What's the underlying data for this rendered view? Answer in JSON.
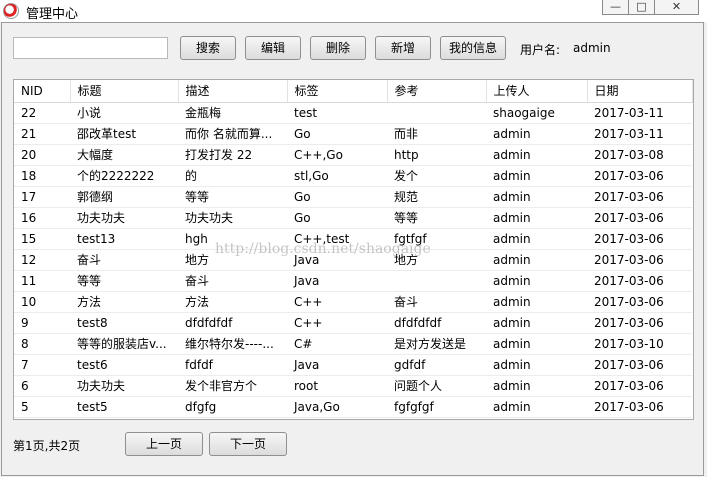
{
  "window": {
    "title": "管理中心",
    "min_label": "—",
    "max_label": "□",
    "close_label": "✕"
  },
  "toolbar": {
    "search_value": "",
    "search_label": "搜索",
    "edit_label": "编辑",
    "delete_label": "删除",
    "add_label": "新增",
    "myinfo_label": "我的信息",
    "user_label": "用户名:",
    "user_name": "admin"
  },
  "table": {
    "columns": [
      "NID",
      "标题",
      "描述",
      "标签",
      "参考",
      "上传人",
      "日期"
    ],
    "rows": [
      [
        "22",
        "小说",
        "金瓶梅",
        "test",
        "",
        "shaogaige",
        "2017-03-11"
      ],
      [
        "21",
        "邵改革test",
        "而你 名就而算...",
        "Go",
        "而非",
        "admin",
        "2017-03-11"
      ],
      [
        "20",
        "大幅度",
        "打发打发 22",
        "C++,Go",
        "http",
        "admin",
        "2017-03-08"
      ],
      [
        "18",
        "个的2222222",
        "的",
        "stl,Go",
        "发个",
        "admin",
        "2017-03-06"
      ],
      [
        "17",
        "郭德纲",
        "等等",
        "Go",
        "规范",
        "admin",
        "2017-03-06"
      ],
      [
        "16",
        "功夫功夫",
        "功夫功夫",
        "Go",
        "等等",
        "admin",
        "2017-03-06"
      ],
      [
        "15",
        "test13",
        "hgh",
        "C++,test",
        "fgtfgf",
        "admin",
        "2017-03-06"
      ],
      [
        "12",
        "奋斗",
        "地方",
        "Java",
        "地方",
        "admin",
        "2017-03-06"
      ],
      [
        "11",
        "等等",
        "奋斗",
        "Java",
        "",
        "admin",
        "2017-03-06"
      ],
      [
        "10",
        "方法",
        "方法",
        "C++",
        "奋斗",
        "admin",
        "2017-03-06"
      ],
      [
        "9",
        "test8",
        "dfdfdfdf",
        "C++",
        "dfdfdfdf",
        "admin",
        "2017-03-06"
      ],
      [
        "8",
        "等等的服装店v...",
        "维尔特尔发----...",
        "C#",
        "是对方发送是",
        "admin",
        "2017-03-10"
      ],
      [
        "7",
        "test6",
        "fdfdf",
        "Java",
        "gdfdf",
        "admin",
        "2017-03-06"
      ],
      [
        "6",
        "功夫功夫",
        "发个非官方个",
        "root",
        "问题个人",
        "admin",
        "2017-03-06"
      ],
      [
        "5",
        "test5",
        "dfgfg",
        "Java,Go",
        "fgfgfgf",
        "admin",
        "2017-03-06"
      ]
    ]
  },
  "watermark": "http://blog.csdn.net/shaogaige",
  "pager": {
    "status": "第1页,共2页",
    "prev_label": "上一页",
    "next_label": "下一页"
  }
}
